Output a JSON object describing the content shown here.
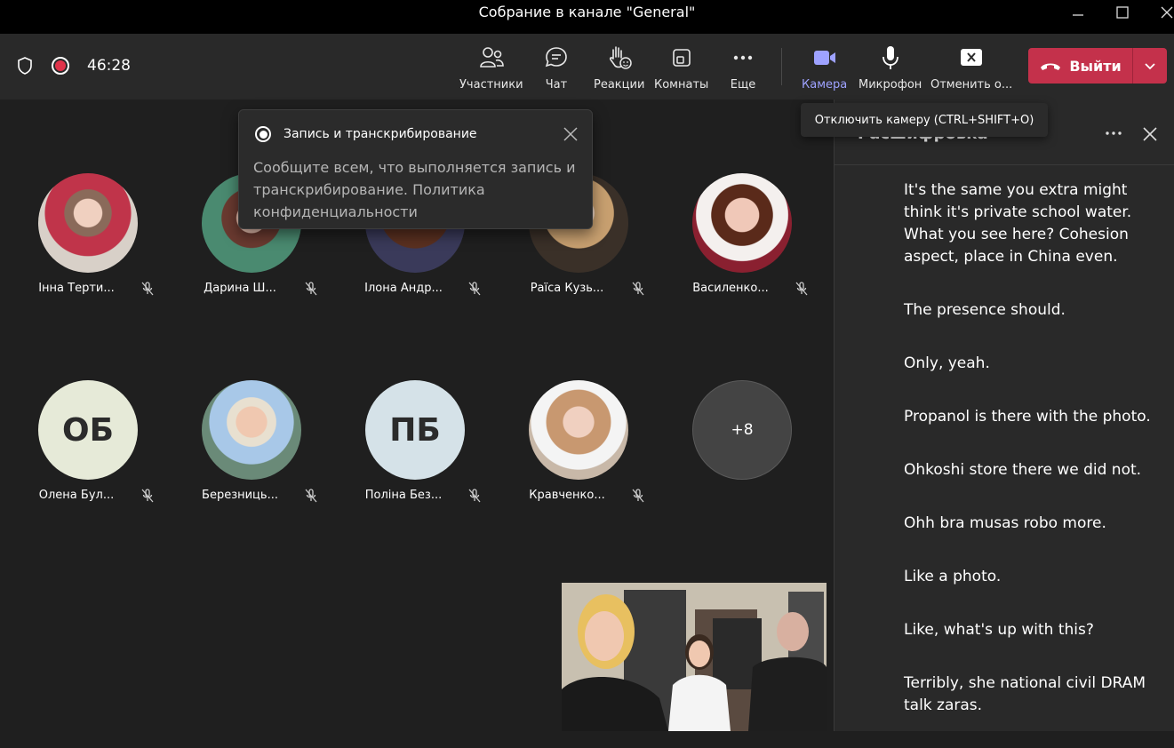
{
  "window": {
    "title": "Собрание в канале \"General\""
  },
  "toolbar": {
    "timer": "46:28",
    "buttons": {
      "participants": "Участники",
      "chat": "Чат",
      "reactions": "Реакции",
      "rooms": "Комнаты",
      "more": "Еще",
      "camera": "Камера",
      "mic": "Микрофон",
      "share": "Отменить о..."
    },
    "leave": "Выйти",
    "colors": {
      "accent": "#9ea2ff",
      "leave": "#c4314b",
      "record": "#e0334a"
    }
  },
  "popup": {
    "title": "Запись и транскрибирование",
    "body": "Сообщите всем, что выполняется запись и транскрибирование. Политика конфиденциальности"
  },
  "tooltip": "Отключить камеру (CTRL+SHIFT+O)",
  "participants": [
    {
      "name": "Інна Терти...",
      "initials": "",
      "bg": "#c9a9a0"
    },
    {
      "name": "Дарина Ш...",
      "initials": "",
      "bg": "#5a8a6a"
    },
    {
      "name": "Ілона Андр...",
      "initials": "",
      "bg": "#6a4a3a"
    },
    {
      "name": "Раїса Кузь...",
      "initials": "",
      "bg": "#b0a090"
    },
    {
      "name": "Василенко...",
      "initials": "",
      "bg": "#d8b8a8"
    },
    {
      "name": "Олена Бул...",
      "initials": "ОБ",
      "bg": "#e6ead8"
    },
    {
      "name": "Березниць...",
      "initials": "",
      "bg": "#7a9aa8"
    },
    {
      "name": "Поліна Без...",
      "initials": "ПБ",
      "bg": "#d5e2e8"
    },
    {
      "name": "Кравченко...",
      "initials": "",
      "bg": "#d8c0b0"
    }
  ],
  "overflow": "+8",
  "transcript": {
    "title": "Расшифровка",
    "entries": [
      "It's the same you extra might think it's private school water. What you see here? Cohesion aspect, place in China even.",
      "The presence should.",
      "Only, yeah.",
      "Propanol is there with the photo.",
      "Ohkoshi store there we did not.",
      "Ohh bra musas robo more.",
      "Like a photo.",
      "Like, what's up with this?",
      "Terribly, she national civil DRAM talk zaras."
    ]
  }
}
